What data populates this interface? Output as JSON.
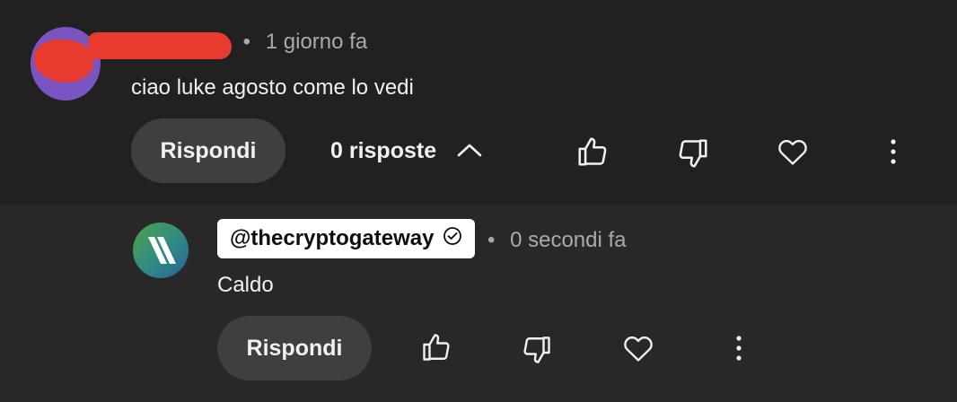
{
  "comment": {
    "timestamp": "1 giorno fa",
    "separator": "•",
    "text": "ciao luke agosto come lo vedi",
    "reply_button": "Rispondi",
    "replies_toggle": "0 risposte",
    "icons": [
      "thumb-up-icon",
      "thumb-down-icon",
      "heart-icon",
      "more-vert-icon"
    ]
  },
  "reply": {
    "handle": "@thecryptogateway",
    "separator": "•",
    "timestamp": "0 secondi fa",
    "text": "Caldo",
    "reply_button": "Rispondi",
    "icons": [
      "verified-icon",
      "thumb-up-icon",
      "thumb-down-icon",
      "heart-icon",
      "more-vert-icon"
    ]
  },
  "colors": {
    "background": "#212121",
    "reply_background": "#282828",
    "button_background": "#3f3f3f",
    "redaction": "#e63b2e",
    "muted_text": "#aaaaaa"
  }
}
